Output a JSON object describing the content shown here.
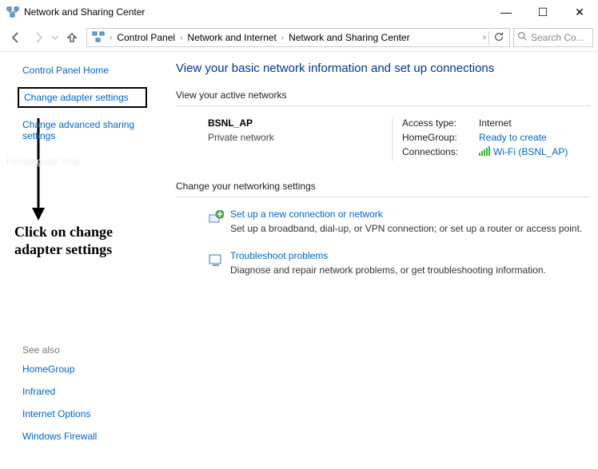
{
  "window": {
    "title": "Network and Sharing Center",
    "minimize": "—",
    "maximize": "☐",
    "close": "✕"
  },
  "nav": {
    "breadcrumb": [
      "Control Panel",
      "Network and Internet",
      "Network and Sharing Center"
    ],
    "searchPlaceholder": "Search Co..."
  },
  "sidebar": {
    "home": "Control Panel Home",
    "adapter": "Change adapter settings",
    "advanced": "Change advanced sharing settings",
    "seeAlsoLabel": "See also",
    "seeAlso": [
      "HomeGroup",
      "Infrared",
      "Internet Options",
      "Windows Firewall"
    ]
  },
  "main": {
    "heading": "View your basic network information and set up connections",
    "activeLabel": "View your active networks",
    "network": {
      "name": "BSNL_AP",
      "type": "Private network"
    },
    "props": {
      "accessKey": "Access type:",
      "accessVal": "Internet",
      "homeKey": "HomeGroup:",
      "homeVal": "Ready to create",
      "connKey": "Connections:",
      "connVal": "Wi-Fi (BSNL_AP)"
    },
    "changeLabel": "Change your networking settings",
    "setup": {
      "title": "Set up a new connection or network",
      "desc": "Set up a broadband, dial-up, or VPN connection; or set up a router or access point."
    },
    "trouble": {
      "title": "Troubleshoot problems",
      "desc": "Diagnose and repair network problems, or get troubleshooting information."
    }
  },
  "annotation": {
    "line1": "Click on change",
    "line2": "adapter settings",
    "faded": "Rectangular Snip"
  }
}
